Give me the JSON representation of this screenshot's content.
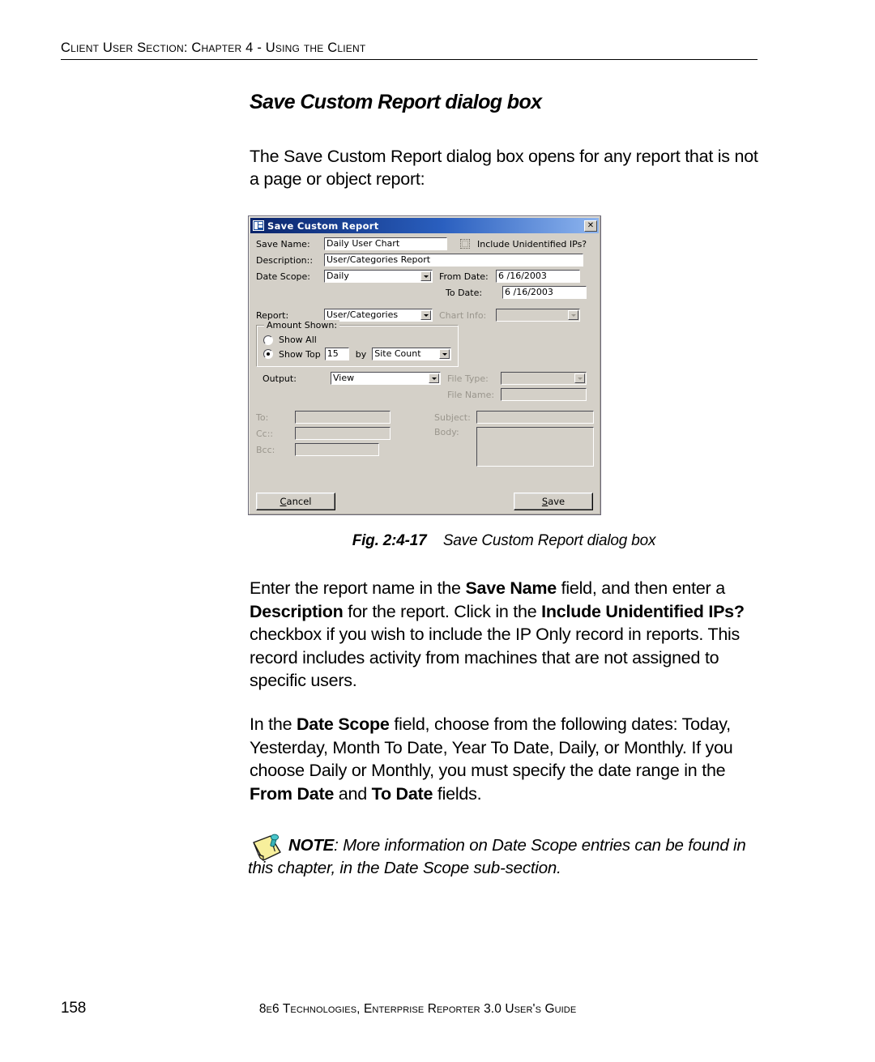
{
  "page": {
    "header": "Client User Section: Chapter 4 - Using the Client",
    "number": "158",
    "footer_title": "8e6 Technologies, Enterprise Reporter 3.0 User's Guide"
  },
  "section": {
    "title": "Save Custom Report dialog box",
    "intro": "The Save Custom Report dialog box opens for any report that is not a page or object report:"
  },
  "figure": {
    "label": "Fig. 2:4-17",
    "title": "Save Custom Report dialog box"
  },
  "dialog": {
    "title": "Save Custom Report",
    "close_label": "✕",
    "fields": {
      "save_name_label": "Save Name:",
      "save_name_value": "Daily User Chart",
      "include_unidentified_label": "Include Unidentified IPs?",
      "description_label": "Description::",
      "description_value": "User/Categories Report",
      "date_scope_label": "Date Scope:",
      "date_scope_value": "Daily",
      "from_date_label": "From Date:",
      "from_date_value": "6 /16/2003",
      "to_date_label": "To Date:",
      "to_date_value": "6 /16/2003",
      "report_label": "Report:",
      "report_value": "User/Categories",
      "chart_info_label": "Chart Info:",
      "chart_info_value": "",
      "output_label": "Output:",
      "output_value": "View",
      "file_type_label": "File Type:",
      "file_type_value": "",
      "file_name_label": "File Name:",
      "file_name_value": "",
      "to_label": "To:",
      "to_value": "",
      "cc_label": "Cc::",
      "cc_value": "",
      "bcc_label": "Bcc:",
      "bcc_value": "",
      "subject_label": "Subject:",
      "subject_value": "",
      "body_label": "Body:",
      "body_value": ""
    },
    "amount_shown": {
      "group_label": "Amount Shown:",
      "show_all_label": "Show All",
      "show_top_label": "Show Top",
      "show_top_value": "15",
      "by_label": "by",
      "by_value": "Site Count",
      "selected": "show_top"
    },
    "buttons": {
      "cancel_accel": "C",
      "cancel_rest": "ancel",
      "save_accel": "S",
      "save_rest": "ave"
    }
  },
  "paragraphs": {
    "p1_a": "Enter the report name in the ",
    "p1_b1": "Save Name",
    "p1_c": " field, and then enter a ",
    "p1_b2": "Description",
    "p1_d": " for the report. Click in the ",
    "p1_b3": "Include Unidentified IPs?",
    "p1_e": " checkbox if you wish to include the IP Only record in reports. This record includes activity from machines that are not assigned to specific users.",
    "p2_a": "In the ",
    "p2_b1": "Date Scope",
    "p2_c": " field, choose from the following dates: Today, Yesterday, Month To Date, Year To Date, Daily, or Monthly. If you choose Daily or Monthly, you must specify the date range in the ",
    "p2_b2": "From Date",
    "p2_d": " and ",
    "p2_b3": "To Date",
    "p2_e": " fields."
  },
  "note": {
    "label": "NOTE",
    "text": ": More information on Date Scope entries can be found in this chapter, in the Date Scope sub-section."
  },
  "colors": {
    "titlebar_start": "#0a246a",
    "titlebar_end": "#8eb5ef",
    "dialog_face": "#d4d0c8",
    "disabled_text": "#9a968d",
    "note_paper": "#f7ef9c",
    "note_pin": "#39b3b8"
  }
}
